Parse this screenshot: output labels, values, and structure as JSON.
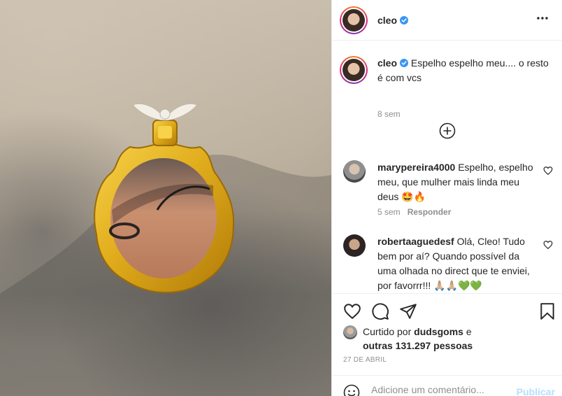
{
  "post": {
    "photo_alt": "",
    "author": "cleo"
  },
  "header": {
    "username": "cleo",
    "verified": true,
    "more_icon": "more-horizontal-icon"
  },
  "caption": {
    "username": "cleo",
    "text": "Espelho espelho meu.... o resto é com vcs",
    "time": "8 sem"
  },
  "load_more_icon": "plus-circle-icon",
  "comments": [
    {
      "username": "marypereira4000",
      "text": "Espelho, espelho meu, que mulher mais linda meu deus 🤩🔥",
      "time": "5 sem",
      "reply_label": "Responder"
    },
    {
      "username": "robertaaguedesf",
      "text": "Olá, Cleo! Tudo bem por aí? Quando possível da uma olhada no direct que te enviei, por favorrr!!! 🙏🏼🙏🏼💚💚"
    }
  ],
  "actions": {
    "like_icon": "heart-icon",
    "comment_icon": "comment-icon",
    "share_icon": "share-icon",
    "save_icon": "bookmark-icon"
  },
  "likes": {
    "prefix": "Curtido por",
    "user": "dudsgoms",
    "mid": "e",
    "others": "outras 131.297 pessoas"
  },
  "date": "27 DE ABRIL",
  "add_comment": {
    "placeholder": "Adicione um comentário...",
    "post_label": "Publicar",
    "emoji_icon": "smile-icon"
  },
  "colors": {
    "verified": "#3897f0",
    "post_disabled": "#b2dffc",
    "muted": "#8e8e8e",
    "text": "#262626"
  }
}
